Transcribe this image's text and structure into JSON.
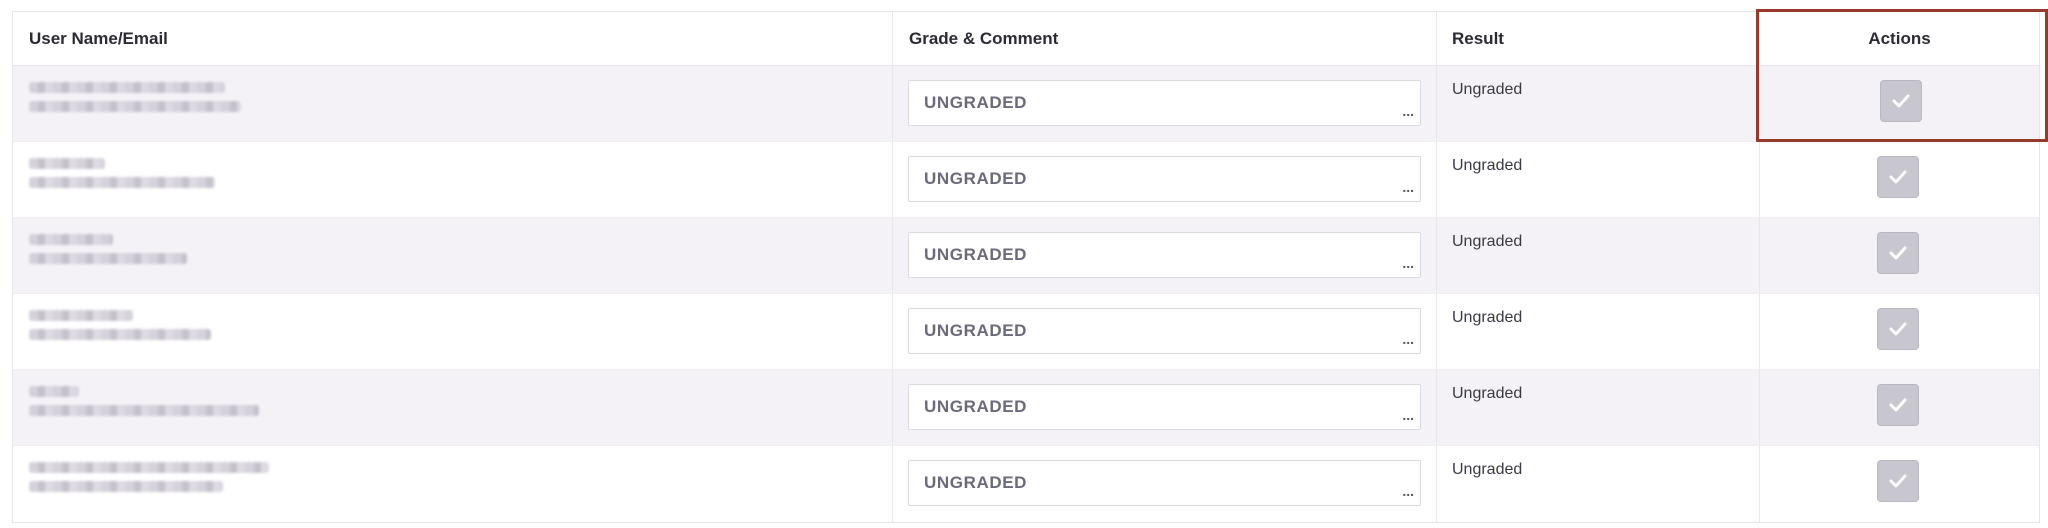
{
  "columns": {
    "user": "User Name/Email",
    "grade": "Grade & Comment",
    "result": "Result",
    "actions": "Actions"
  },
  "rows": [
    {
      "grade": "UNGRADED",
      "more": "...",
      "result": "Ungraded",
      "action_icon": "check-icon"
    },
    {
      "grade": "UNGRADED",
      "more": "...",
      "result": "Ungraded",
      "action_icon": "check-icon"
    },
    {
      "grade": "UNGRADED",
      "more": "...",
      "result": "Ungraded",
      "action_icon": "check-icon"
    },
    {
      "grade": "UNGRADED",
      "more": "...",
      "result": "Ungraded",
      "action_icon": "check-icon"
    },
    {
      "grade": "UNGRADED",
      "more": "...",
      "result": "Ungraded",
      "action_icon": "check-icon"
    },
    {
      "grade": "UNGRADED",
      "more": "...",
      "result": "Ungraded",
      "action_icon": "check-icon"
    }
  ],
  "colors": {
    "highlight_border": "#963a2a",
    "alt_row_bg": "#f5f2f7",
    "action_button_bg": "#c8c6cf"
  }
}
